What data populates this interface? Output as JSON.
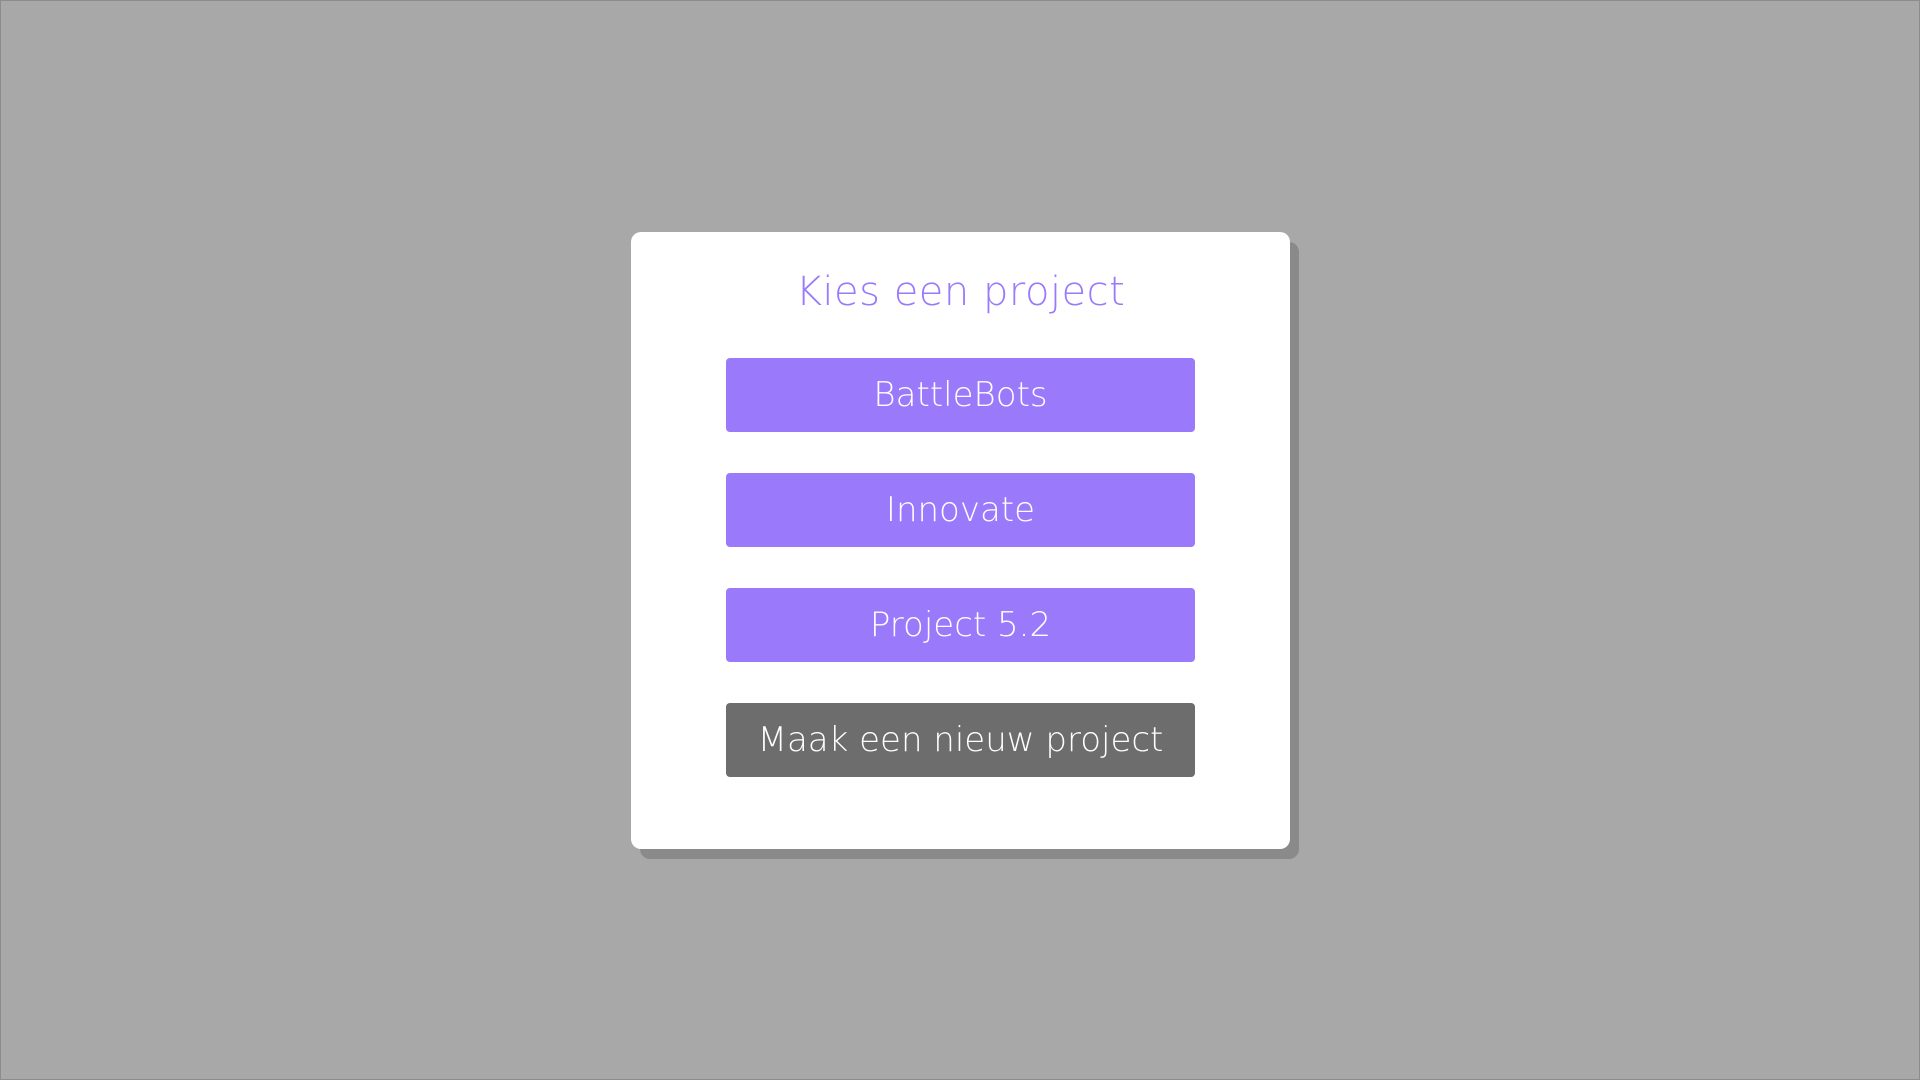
{
  "dialog": {
    "title": "Kies een project",
    "projects": [
      {
        "label": "BattleBots"
      },
      {
        "label": "Innovate"
      },
      {
        "label": "Project 5.2"
      }
    ],
    "new_project_label": "Maak een nieuw project"
  },
  "colors": {
    "background": "#a8a8a8",
    "accent": "#9a79fb",
    "secondary_button": "#6d6d6d",
    "dialog": "#ffffff"
  }
}
